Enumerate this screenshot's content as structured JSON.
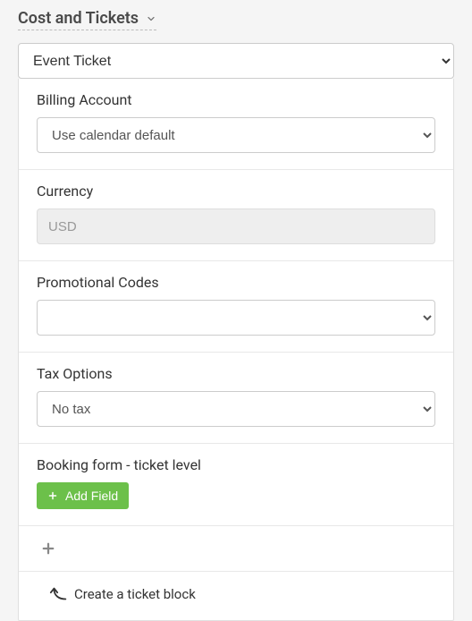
{
  "header": {
    "title": "Cost and Tickets"
  },
  "ticketType": {
    "selected": "Event Ticket"
  },
  "billingAccount": {
    "label": "Billing Account",
    "selected": "Use calendar default"
  },
  "currency": {
    "label": "Currency",
    "value": "USD"
  },
  "promoCodes": {
    "label": "Promotional Codes",
    "selected": ""
  },
  "taxOptions": {
    "label": "Tax Options",
    "selected": "No tax"
  },
  "bookingForm": {
    "label": "Booking form - ticket level",
    "addFieldLabel": "Add Field"
  },
  "ticketBlock": {
    "hint": "Create a ticket block"
  }
}
